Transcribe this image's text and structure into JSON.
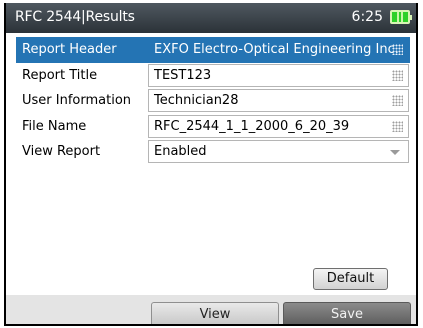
{
  "titlebar": {
    "title": "RFC 2544|Results",
    "clock": "6:25",
    "battery_icon": "battery-charging-icon",
    "battery_color": "#2fd12a"
  },
  "form": {
    "rows": [
      {
        "label": "Report Header",
        "value": "EXFO Electro-Optical Engineering Inc.",
        "selected": true
      },
      {
        "label": "Report Title",
        "value": "TEST123"
      },
      {
        "label": "User Information",
        "value": "Technician28"
      },
      {
        "label": "File Name",
        "value": "RFC_2544_1_1_2000_6_20_39"
      },
      {
        "label": "View Report",
        "value": "Enabled",
        "type": "dropdown"
      }
    ],
    "selected_color": "#2474b4"
  },
  "buttons": {
    "default_label": "Default"
  },
  "softkeys": {
    "view_label": "View",
    "save_label": "Save"
  }
}
